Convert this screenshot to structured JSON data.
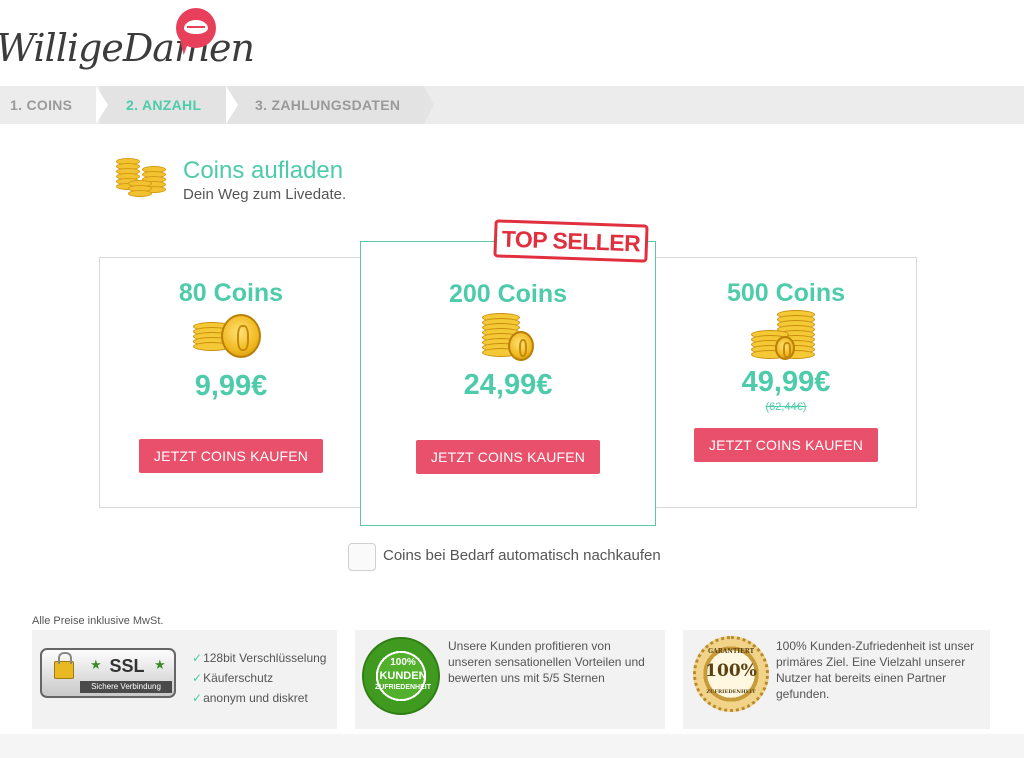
{
  "brand": {
    "logo_text": "WilligeDamen",
    "accent_color": "#4dcbaa",
    "cta_color": "#e9506b",
    "badge_color": "#e0303e"
  },
  "steps": [
    {
      "label": "1. COINS",
      "active": false
    },
    {
      "label": "2. ANZAHL",
      "active": true
    },
    {
      "label": "3. ZAHLUNGSDATEN",
      "active": false
    }
  ],
  "heading": {
    "title": "Coins aufladen",
    "subtitle": "Dein Weg zum Livedate.",
    "icon": "coins-stack-icon"
  },
  "packages": [
    {
      "amount": "80 Coins",
      "price": "9,99€",
      "old_price": "",
      "cta": "JETZT COINS KAUFEN",
      "icon": "coins-icon"
    },
    {
      "amount": "200 Coins",
      "price": "24,99€",
      "old_price": "",
      "cta": "JETZT COINS KAUFEN",
      "badge": "TOP SELLER",
      "icon": "coin-stack-icon"
    },
    {
      "amount": "500 Coins",
      "price": "49,99€",
      "old_price": "(62,44€)",
      "cta": "JETZT COINS KAUFEN",
      "icon": "coin-stacks-icon"
    }
  ],
  "auto_refill": {
    "label": "Coins bei Bedarf automatisch nachkaufen",
    "checked": false
  },
  "footer": {
    "vat_note": "Alle Preise inklusive MwSt.",
    "ssl_badge": {
      "title": "SSL",
      "subtitle": "Sichere Verbindung"
    },
    "security_points": [
      "128bit Verschlüsselung",
      "Käuferschutz",
      "anonym und diskret"
    ],
    "check_glyph": "✓",
    "satisfaction_seal": {
      "top": "100%",
      "middle": "KUNDEN",
      "bottom": "ZUFRIEDENHEIT"
    },
    "satisfaction_text": "Unsere Kunden profitieren von unseren sensationellen Vorteilen und bewerten uns mit 5/5 Sternen",
    "guarantee_seal": {
      "top": "GARANTIERT",
      "middle": "100%",
      "bottom": "ZUFRIEDENHEIT"
    },
    "guarantee_text": "100% Kunden-Zufriedenheit ist unser primäres Ziel. Eine Vielzahl unserer Nutzer hat bereits einen Partner gefunden."
  }
}
